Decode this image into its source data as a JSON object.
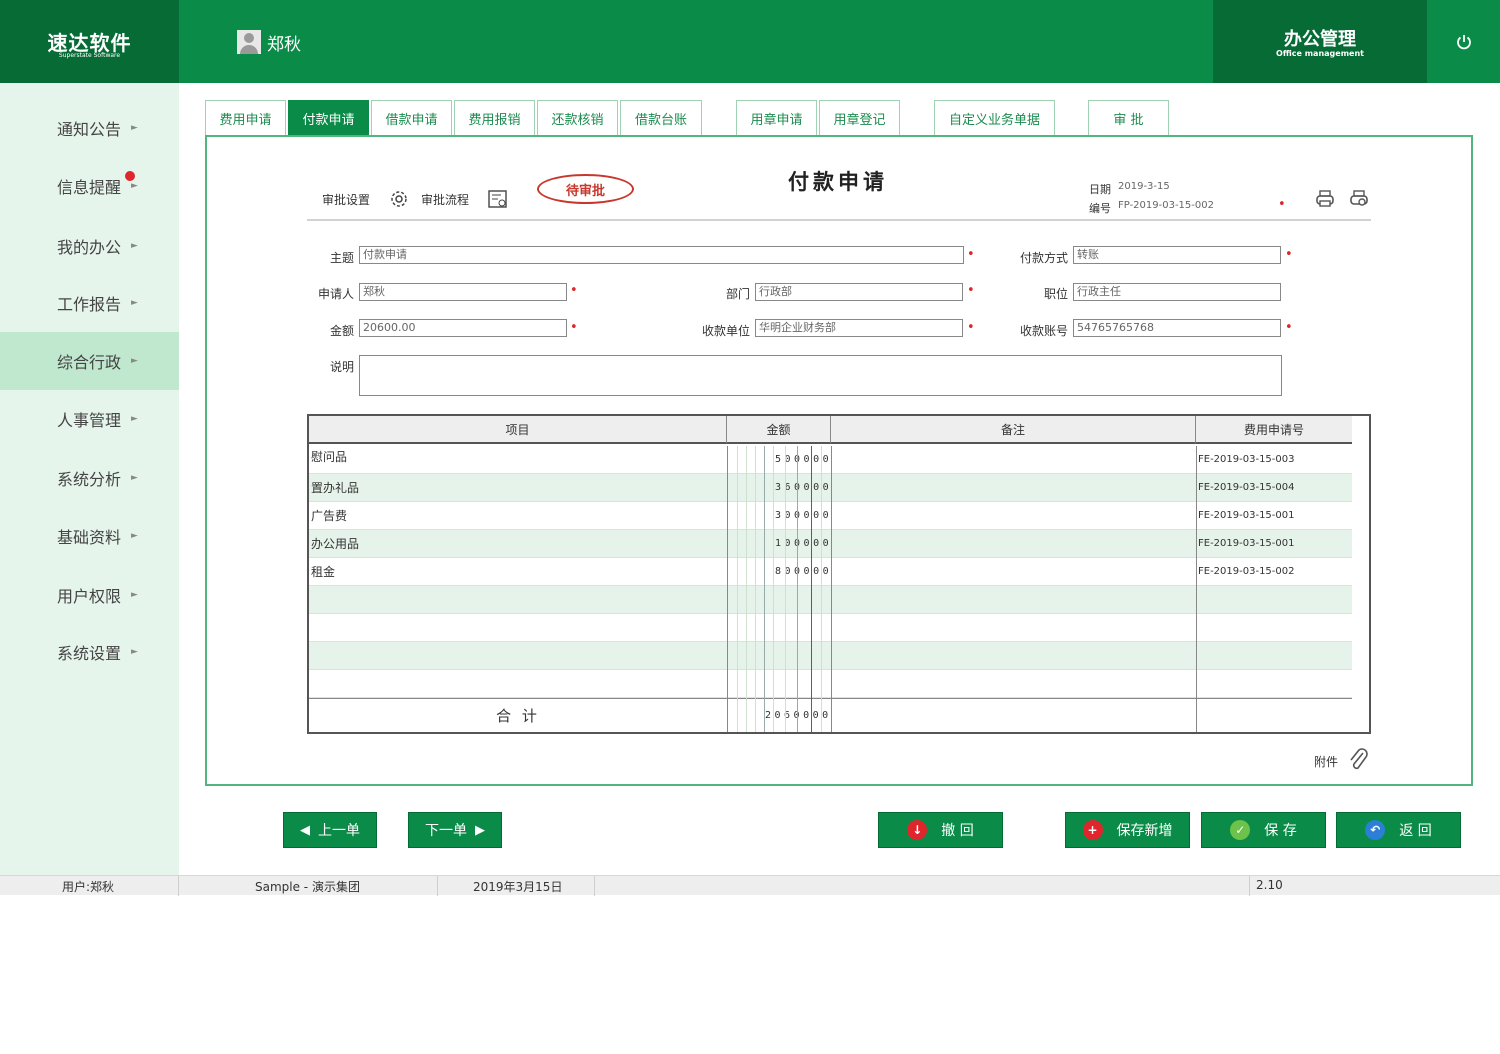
{
  "header": {
    "logo_title": "速达软件",
    "logo_subtitle": "Superstate Software",
    "user_name": "郑秋",
    "module_title": "办公管理",
    "module_subtitle": "Office management"
  },
  "sidebar": {
    "items": [
      {
        "label": "通知公告"
      },
      {
        "label": "信息提醒"
      },
      {
        "label": "我的办公"
      },
      {
        "label": "工作报告"
      },
      {
        "label": "综合行政"
      },
      {
        "label": "人事管理"
      },
      {
        "label": "系统分析"
      },
      {
        "label": "基础资料"
      },
      {
        "label": "用户权限"
      },
      {
        "label": "系统设置"
      }
    ],
    "active_index": 4
  },
  "tabs": [
    {
      "label": "费用申请"
    },
    {
      "label": "付款申请"
    },
    {
      "label": "借款申请"
    },
    {
      "label": "费用报销"
    },
    {
      "label": "还款核销"
    },
    {
      "label": "借款台账"
    },
    {
      "label": "用章申请"
    },
    {
      "label": "用章登记"
    },
    {
      "label": "自定义业务单据"
    },
    {
      "label": "审 批"
    }
  ],
  "form": {
    "approval_settings": "审批设置",
    "approval_flow": "审批流程",
    "status_stamp": "待审批",
    "title": "付款申请",
    "date_label": "日期",
    "date_value": "2019-3-15",
    "number_label": "编号",
    "number_value": "FP-2019-03-15-002",
    "subject_label": "主题",
    "subject_value": "付款申请",
    "pay_method_label": "付款方式",
    "pay_method_value": "转账",
    "applicant_label": "申请人",
    "applicant_value": "郑秋",
    "dept_label": "部门",
    "dept_value": "行政部",
    "position_label": "职位",
    "position_value": "行政主任",
    "amount_label": "金额",
    "amount_value": "20600.00",
    "payee_label": "收款单位",
    "payee_value": "华明企业财务部",
    "account_label": "收款账号",
    "account_value": "54765765768",
    "note_label": "说明",
    "note_value": "",
    "attachment_label": "附件"
  },
  "grid": {
    "headers": [
      "项目",
      "金额",
      "备注",
      "费用申请号"
    ],
    "rows": [
      {
        "item": "慰问品",
        "amount": "500000",
        "remark": "",
        "request_no": "FE-2019-03-15-003"
      },
      {
        "item": "置办礼品",
        "amount": "360000",
        "remark": "",
        "request_no": "FE-2019-03-15-004"
      },
      {
        "item": "广告费",
        "amount": "300000",
        "remark": "",
        "request_no": "FE-2019-03-15-001"
      },
      {
        "item": "办公用品",
        "amount": "100000",
        "remark": "",
        "request_no": "FE-2019-03-15-001"
      },
      {
        "item": "租金",
        "amount": "800000",
        "remark": "",
        "request_no": "FE-2019-03-15-002"
      }
    ],
    "empty_rows": 4,
    "total_label": "合 计",
    "total_value": "2060000"
  },
  "buttons": {
    "prev": "上一单",
    "next": "下一单",
    "revoke": "撤 回",
    "save_new": "保存新增",
    "save": "保 存",
    "back": "返 回"
  },
  "status_bar": {
    "user": "用户:郑秋",
    "company": "Sample - 演示集团",
    "date": "2019年3月15日",
    "version": "2.10"
  },
  "colors": {
    "brand_green": "#0a8c48",
    "dark_green": "#076b36",
    "required_red": "#e0262c"
  }
}
